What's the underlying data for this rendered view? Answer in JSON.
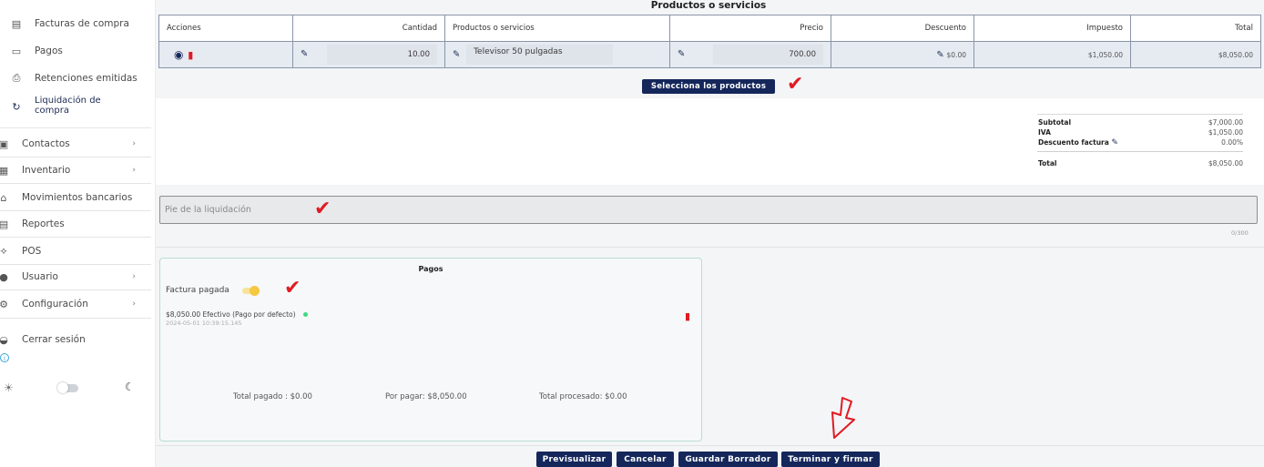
{
  "sidebar": {
    "items": [
      {
        "label": "Facturas de compra",
        "icon": "document-list-icon"
      },
      {
        "label": "Pagos",
        "icon": "card-icon"
      },
      {
        "label": "Retenciones emitidas",
        "icon": "receipt-hand-icon"
      },
      {
        "label": "Liquidación de compra",
        "icon": "refresh-dollar-icon"
      },
      {
        "label": "Contactos",
        "icon": "contacts-icon"
      },
      {
        "label": "Inventario",
        "icon": "inventory-icon"
      },
      {
        "label": "Movimientos bancarios",
        "icon": "bank-icon"
      },
      {
        "label": "Reportes",
        "icon": "report-icon"
      },
      {
        "label": "POS",
        "icon": "pos-icon"
      },
      {
        "label": "Usuario",
        "icon": "user-icon"
      },
      {
        "label": "Configuración",
        "icon": "gear-icon"
      },
      {
        "label": "Cerrar sesión",
        "icon": "logout-icon"
      }
    ]
  },
  "products": {
    "title": "Productos o servicios",
    "headers": [
      "Acciones",
      "Cantidad",
      "Productos o servicios",
      "Precio",
      "Descuento",
      "Impuesto",
      "Total"
    ],
    "row": {
      "cantidad": "10.00",
      "producto": "Televisor 50 pulgadas",
      "precio": "700.00",
      "descuento": "$0.00",
      "impuesto": "$1,050.00",
      "total": "$8,050.00"
    },
    "select_button": "Selecciona los productos"
  },
  "totals": {
    "subtotal_label": "Subtotal",
    "subtotal": "$7,000.00",
    "iva_label": "IVA",
    "iva": "$1,050.00",
    "descuento_label": "Descuento factura",
    "descuento": "0.00%",
    "total_label": "Total",
    "total": "$8,050.00"
  },
  "footer": {
    "placeholder": "Pie de la liquidación",
    "counter": "0/300"
  },
  "pagos": {
    "title": "Pagos",
    "toggle_label": "Factura pagada",
    "toggle_on": true,
    "payment_line": "$8,050.00 Efectivo (Pago por defecto)",
    "payment_date": "2024-05-01 10:39:15.145",
    "total_pagado": "Total pagado : $0.00",
    "por_pagar": "Por pagar: $8,050.00",
    "total_procesado": "Total procesado: $0.00"
  },
  "actions": {
    "preview": "Previsualizar",
    "cancel": "Cancelar",
    "save_draft": "Guardar Borrador",
    "finish": "Terminar y firmar"
  },
  "colors": {
    "accent": "#15275a",
    "delete": "#e01b22",
    "check_mark": "#e01b22",
    "toggle": "#f5c842",
    "status_dot": "#3ddc84"
  }
}
